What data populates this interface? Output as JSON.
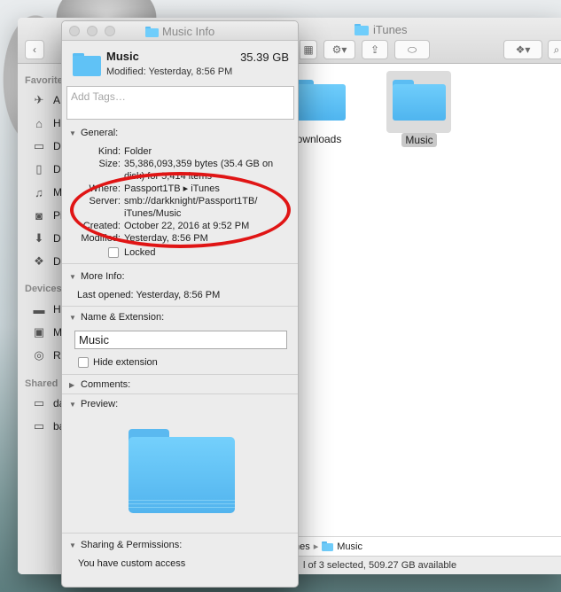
{
  "finder": {
    "title": "iTunes",
    "sidebar": {
      "favorites_label": "Favorite",
      "favorites": [
        {
          "label": "A",
          "icon": "applications-icon"
        },
        {
          "label": "H",
          "icon": "home-icon"
        },
        {
          "label": "D",
          "icon": "desktop-icon"
        },
        {
          "label": "D",
          "icon": "documents-icon"
        },
        {
          "label": "M",
          "icon": "music-icon"
        },
        {
          "label": "Pi",
          "icon": "camera-icon"
        },
        {
          "label": "D",
          "icon": "downloads-icon"
        },
        {
          "label": "D",
          "icon": "dropbox-icon"
        }
      ],
      "devices_label": "Devices",
      "devices": [
        {
          "label": "H",
          "icon": "laptop-icon"
        },
        {
          "label": "M",
          "icon": "disk-icon"
        },
        {
          "label": "Re",
          "icon": "cd-icon"
        }
      ],
      "shared_label": "Shared",
      "shared": [
        {
          "label": "da",
          "icon": "computer-icon"
        },
        {
          "label": "ba",
          "icon": "computer-icon"
        }
      ]
    },
    "files": [
      {
        "label": "ownloads"
      },
      {
        "label": "Music"
      }
    ],
    "pathbar": {
      "prefix": "nes",
      "current": "Music"
    },
    "status": "l of 3 selected, 509.27 GB available"
  },
  "info": {
    "title": "Music Info",
    "name": "Music",
    "size": "35.39 GB",
    "modified_line": "Modified: Yesterday, 8:56 PM",
    "tags_placeholder": "Add Tags…",
    "general": {
      "heading": "General:",
      "kind_label": "Kind:",
      "kind": "Folder",
      "size_label": "Size:",
      "size_line1": "35,386,093,359 bytes (35.4 GB on",
      "size_line2": "disk) for 5,414 items",
      "where_label": "Where:",
      "where": "Passport1TB ▸ iTunes",
      "server_label": "Server:",
      "server_line1": "smb://darkknight/Passport1TB/",
      "server_line2": "iTunes/Music",
      "created_label": "Created:",
      "created": "October 22, 2016 at 9:52 PM",
      "modified_label": "Modified:",
      "modified": "Yesterday, 8:56 PM",
      "locked_label": "Locked"
    },
    "more_info": {
      "heading": "More Info:",
      "last_opened": "Last opened: Yesterday, 8:56 PM"
    },
    "name_ext": {
      "heading": "Name & Extension:",
      "value": "Music",
      "hide_ext_label": "Hide extension"
    },
    "comments": {
      "heading": "Comments:"
    },
    "preview": {
      "heading": "Preview:"
    },
    "sharing": {
      "heading": "Sharing & Permissions:",
      "text": "You have custom access"
    }
  },
  "colors": {
    "folder": "#5bbdf3",
    "highlight_ring": "#e01515"
  }
}
